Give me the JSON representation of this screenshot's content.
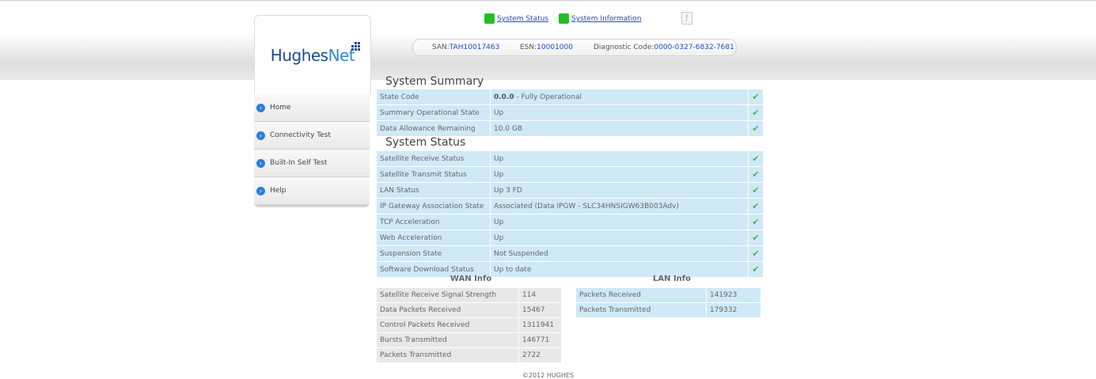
{
  "brand": {
    "logo_main": "Hughes",
    "logo_accent": "Net"
  },
  "toplinks": [
    {
      "label": "System Status"
    },
    {
      "label": "System Information"
    }
  ],
  "infobar": {
    "san_label": "SAN:",
    "san_value": "TAH10017463",
    "esn_label": "ESN:",
    "esn_value": "10001000",
    "diag_label": "Diagnostic Code:",
    "diag_value": "0000-0327-6832-7681"
  },
  "nav": [
    {
      "label": "Home"
    },
    {
      "label": "Connectivity Test"
    },
    {
      "label": "Built-In Self Test"
    },
    {
      "label": "Help"
    }
  ],
  "summary": {
    "title": "System Summary",
    "rows": [
      {
        "label": "State Code",
        "code": "0.0.0",
        "value": " - Fully Operational",
        "status": "ok"
      },
      {
        "label": "Summary Operational State",
        "value": "Up",
        "status": "ok"
      },
      {
        "label": "Data Allowance Remaining",
        "value": "10.0 GB",
        "status": "ok"
      }
    ]
  },
  "status": {
    "title": "System Status",
    "rows": [
      {
        "label": "Satellite Receive Status",
        "value": "Up",
        "status": "ok"
      },
      {
        "label": "Satellite Transmit Status",
        "value": "Up",
        "status": "ok"
      },
      {
        "label": "LAN Status",
        "value": "Up 3 FD",
        "status": "ok"
      },
      {
        "label": "IP Gateway Association State",
        "value": "Associated (Data IPGW - SLC34HNSIGW63B003Adv)",
        "status": "ok"
      },
      {
        "label": "TCP Acceleration",
        "value": "Up",
        "status": "ok"
      },
      {
        "label": "Web Acceleration",
        "value": "Up",
        "status": "ok"
      },
      {
        "label": "Suspension State",
        "value": "Not Suspended",
        "status": "ok"
      },
      {
        "label": "Software Download Status",
        "value": "Up to date",
        "status": "ok"
      }
    ]
  },
  "wan": {
    "title": "WAN Info",
    "rows": [
      {
        "label": "Satellite Receive Signal Strength",
        "value": "114"
      },
      {
        "label": "Data Packets Received",
        "value": "15467"
      },
      {
        "label": "Control Packets Received",
        "value": "1311941"
      },
      {
        "label": "Bursts Transmitted",
        "value": "146771"
      },
      {
        "label": "Packets Transmitted",
        "value": "2722"
      }
    ]
  },
  "lan": {
    "title": "LAN Info",
    "rows": [
      {
        "label": "Packets Received",
        "value": "141923"
      },
      {
        "label": "Packets Transmitted",
        "value": "179332"
      }
    ]
  },
  "footer": "©2012 HUGHES",
  "colors": {
    "accent": "#2c7fd6",
    "ok": "#4fb14f",
    "link": "#1a4fc0",
    "row": "#cfe9f7"
  },
  "icons": {
    "status_ok": "check-icon",
    "nav": "arrow-circle-icon",
    "toplink": "green-square-icon",
    "page": "page-icon"
  }
}
